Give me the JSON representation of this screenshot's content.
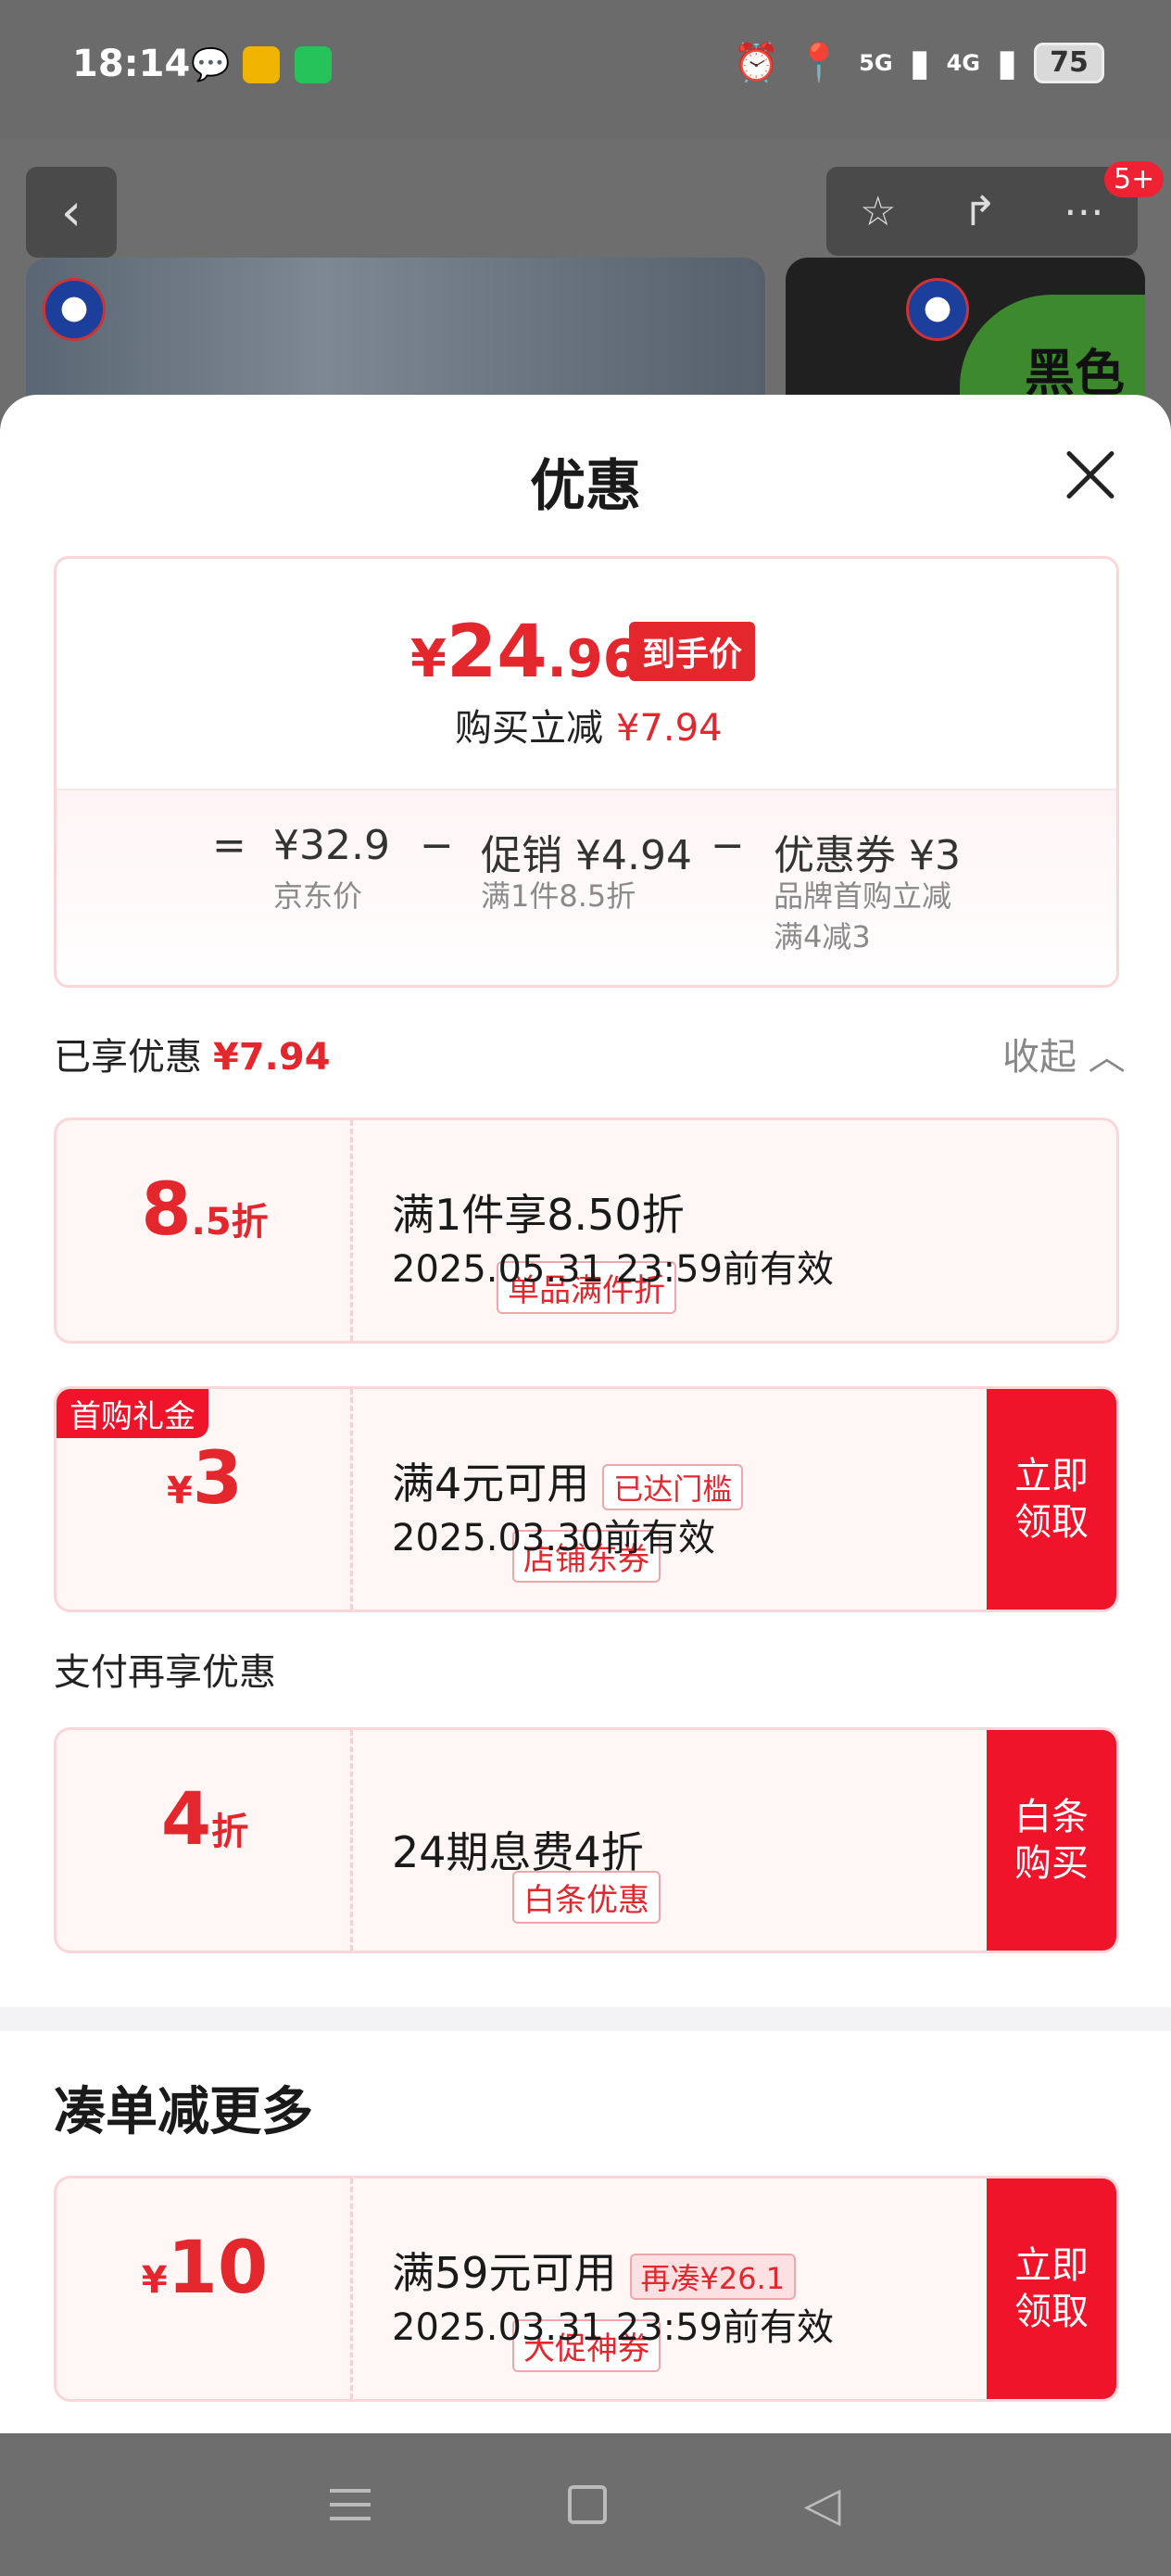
{
  "status": {
    "time": "18:14",
    "battery": "75",
    "signal1": "5G",
    "signal2": "4G"
  },
  "background": {
    "badge": "5+",
    "banner_text": "黑色"
  },
  "sheet": {
    "title": "优惠",
    "final_price": {
      "currency": "¥",
      "integer": "24",
      "decimal": ".96",
      "tag": "到手价"
    },
    "saving": {
      "label": "购买立减",
      "amount": "¥7.94"
    },
    "formula": {
      "eq": "=",
      "minus": "−",
      "jd_price": "¥32.9",
      "jd_label": "京东价",
      "promo_label": "促销",
      "promo_value": "¥4.94",
      "promo_desc": "满1件8.5折",
      "coupon_label": "优惠券",
      "coupon_value": "¥3",
      "coupon_desc1": "品牌首购立减",
      "coupon_desc2": "满4减3"
    },
    "enjoyed": {
      "label": "已享优惠",
      "amount": "¥7.94",
      "collapse": "收起"
    },
    "cards": [
      {
        "amount": "8",
        "unit": ".5折",
        "type": "单品满件折",
        "line1": "满1件享8.50折",
        "line2": "2025.05.31 23:59前有效"
      },
      {
        "ribbon": "首购礼金",
        "prefix": "¥",
        "amount": "3",
        "type": "店铺东券",
        "line1": "满4元可用",
        "pill": "已达门槛",
        "line2": "2025.03.30前有效",
        "action": "立即\n领取"
      }
    ],
    "pay_section": "支付再享优惠",
    "pay_card": {
      "amount": "4",
      "unit": "折",
      "type": "白条优惠",
      "line1": "24期息费4折",
      "action": "白条\n购买"
    },
    "more_title": "凑单减更多",
    "more_card": {
      "prefix": "¥",
      "amount": "10",
      "type": "大促神券",
      "line1": "满59元可用",
      "pill": "再凑¥26.1",
      "line2": "2025.03.31 23:59前有效",
      "action": "立即\n领取"
    }
  },
  "colors": {
    "accent": "#e4262d",
    "action_bg": "#f0142a",
    "card_bg": "#fff6f6",
    "card_border": "#fbd6d9"
  }
}
